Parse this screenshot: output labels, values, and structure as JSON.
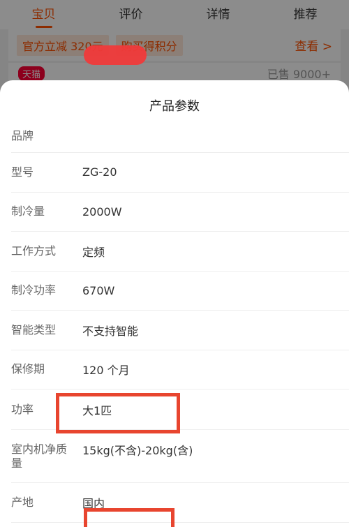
{
  "tabs": [
    "宝贝",
    "评价",
    "详情",
    "推荐"
  ],
  "promo": {
    "tag1": "官方立减 320元",
    "tag2": "购买得积分",
    "link": "查看 >"
  },
  "store": {
    "badge": "天猫",
    "sold": "已售 9000+"
  },
  "sheet": {
    "title": "产品参数",
    "rows": [
      {
        "label": "品牌",
        "value": ""
      },
      {
        "label": "型号",
        "value": "ZG-20"
      },
      {
        "label": "制冷量",
        "value": "2000W"
      },
      {
        "label": "工作方式",
        "value": "定频"
      },
      {
        "label": "制冷功率",
        "value": "670W"
      },
      {
        "label": "智能类型",
        "value": "不支持智能"
      },
      {
        "label": "保修期",
        "value": "120 个月"
      },
      {
        "label": "功率",
        "value": "大1匹"
      },
      {
        "label": "室内机净质量",
        "value": "15kg(不含)-20kg(含)"
      },
      {
        "label": "产地",
        "value": "国内"
      }
    ]
  },
  "colors": {
    "accent": "#ff5000",
    "annotation": "#e8452f"
  }
}
